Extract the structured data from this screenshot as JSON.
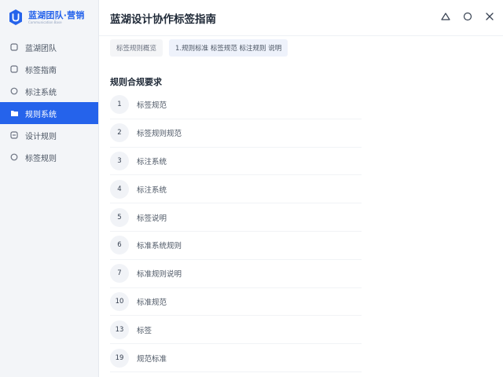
{
  "brand": {
    "title": "蓝湖团队·营销",
    "subtitle": "Communication Base"
  },
  "sidebar": {
    "items": [
      {
        "label": "蓝湖团队",
        "icon": "square-icon",
        "active": false
      },
      {
        "label": "标签指南",
        "icon": "square-icon",
        "active": false
      },
      {
        "label": "标注系统",
        "icon": "circle-icon",
        "active": false
      },
      {
        "label": "规则系统",
        "icon": "folder-icon",
        "active": true
      },
      {
        "label": "设计规则",
        "icon": "minus-square-icon",
        "active": false
      },
      {
        "label": "标签规则",
        "icon": "circle-icon",
        "active": false
      }
    ]
  },
  "header": {
    "title": "蓝湖设计协作标签指南"
  },
  "tabs": [
    {
      "label": "标签规则概览",
      "selected": false
    },
    {
      "label": "1.规则标准 标签规范 标注规则 说明",
      "selected": true
    }
  ],
  "section": {
    "title": "规则合规要求"
  },
  "list": [
    {
      "num": "1",
      "label": "标签规范"
    },
    {
      "num": "2",
      "label": "标签规则规范"
    },
    {
      "num": "3",
      "label": "标注系统"
    },
    {
      "num": "4",
      "label": "标注系统"
    },
    {
      "num": "5",
      "label": "标签说明"
    },
    {
      "num": "6",
      "label": "标准系统规则"
    },
    {
      "num": "7",
      "label": "标准规则说明"
    },
    {
      "num": "10",
      "label": "标准规范"
    },
    {
      "num": "13",
      "label": "标签"
    },
    {
      "num": "19",
      "label": "规范标准"
    }
  ],
  "colors": {
    "accent": "#2563eb",
    "sidebar_bg": "#f3f5f8"
  }
}
